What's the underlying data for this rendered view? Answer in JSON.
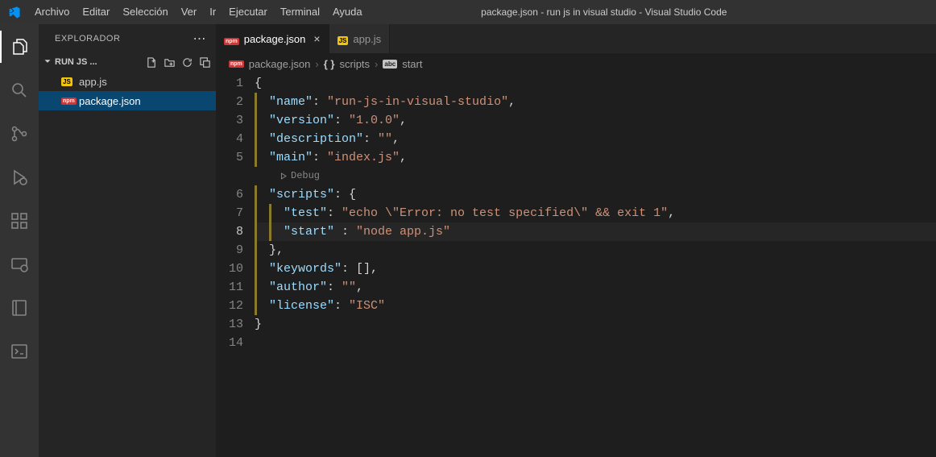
{
  "window_title": "package.json - run js in visual studio - Visual Studio Code",
  "menu": [
    "Archivo",
    "Editar",
    "Selección",
    "Ver",
    "Ir",
    "Ejecutar",
    "Terminal",
    "Ayuda"
  ],
  "sidebar": {
    "title": "EXPLORADOR",
    "section": "RUN JS ...",
    "files": [
      {
        "name": "app.js",
        "iconType": "js",
        "selected": false
      },
      {
        "name": "package.json",
        "iconType": "npm",
        "selected": true
      }
    ]
  },
  "tabs": [
    {
      "label": "package.json",
      "iconType": "npm",
      "active": true,
      "dirty": false,
      "close": true
    },
    {
      "label": "app.js",
      "iconType": "js",
      "active": false,
      "dirty": false,
      "close": false
    }
  ],
  "breadcrumbs": [
    {
      "icon": "npm",
      "label": "package.json"
    },
    {
      "icon": "braces",
      "label": "scripts"
    },
    {
      "icon": "abc",
      "label": "start"
    }
  ],
  "debug_hint": "Debug",
  "active_line": 8,
  "code_lines": [
    {
      "n": 1,
      "tokens": [
        {
          "t": "{",
          "c": "brace"
        }
      ]
    },
    {
      "n": 2,
      "indent": 1,
      "tokens": [
        {
          "t": "\"name\"",
          "c": "key"
        },
        {
          "t": ": ",
          "c": "punc"
        },
        {
          "t": "\"run-js-in-visual-studio\"",
          "c": "str"
        },
        {
          "t": ",",
          "c": "punc"
        }
      ]
    },
    {
      "n": 3,
      "indent": 1,
      "tokens": [
        {
          "t": "\"version\"",
          "c": "key"
        },
        {
          "t": ": ",
          "c": "punc"
        },
        {
          "t": "\"1.0.0\"",
          "c": "str"
        },
        {
          "t": ",",
          "c": "punc"
        }
      ]
    },
    {
      "n": 4,
      "indent": 1,
      "tokens": [
        {
          "t": "\"description\"",
          "c": "key"
        },
        {
          "t": ": ",
          "c": "punc"
        },
        {
          "t": "\"\"",
          "c": "str"
        },
        {
          "t": ",",
          "c": "punc"
        }
      ]
    },
    {
      "n": 5,
      "indent": 1,
      "tokens": [
        {
          "t": "\"main\"",
          "c": "key"
        },
        {
          "t": ": ",
          "c": "punc"
        },
        {
          "t": "\"index.js\"",
          "c": "str"
        },
        {
          "t": ",",
          "c": "punc"
        }
      ]
    },
    {
      "n": 6,
      "indent": 1,
      "tokens": [
        {
          "t": "\"scripts\"",
          "c": "key"
        },
        {
          "t": ": ",
          "c": "punc"
        },
        {
          "t": "{",
          "c": "brace"
        }
      ]
    },
    {
      "n": 7,
      "indent": 2,
      "tokens": [
        {
          "t": "\"test\"",
          "c": "key"
        },
        {
          "t": ": ",
          "c": "punc"
        },
        {
          "t": "\"echo \\\"Error: no test specified\\\" && exit 1\"",
          "c": "str"
        },
        {
          "t": ",",
          "c": "punc"
        }
      ]
    },
    {
      "n": 8,
      "indent": 2,
      "tokens": [
        {
          "t": "\"start\"",
          "c": "key"
        },
        {
          "t": " : ",
          "c": "punc"
        },
        {
          "t": "\"node app.js\"",
          "c": "str"
        }
      ]
    },
    {
      "n": 9,
      "indent": 1,
      "tokens": [
        {
          "t": "}",
          "c": "brace"
        },
        {
          "t": ",",
          "c": "punc"
        }
      ]
    },
    {
      "n": 10,
      "indent": 1,
      "tokens": [
        {
          "t": "\"keywords\"",
          "c": "key"
        },
        {
          "t": ": ",
          "c": "punc"
        },
        {
          "t": "[]",
          "c": "punc"
        },
        {
          "t": ",",
          "c": "punc"
        }
      ]
    },
    {
      "n": 11,
      "indent": 1,
      "tokens": [
        {
          "t": "\"author\"",
          "c": "key"
        },
        {
          "t": ": ",
          "c": "punc"
        },
        {
          "t": "\"\"",
          "c": "str"
        },
        {
          "t": ",",
          "c": "punc"
        }
      ]
    },
    {
      "n": 12,
      "indent": 1,
      "tokens": [
        {
          "t": "\"license\"",
          "c": "key"
        },
        {
          "t": ": ",
          "c": "punc"
        },
        {
          "t": "\"ISC\"",
          "c": "str"
        }
      ]
    },
    {
      "n": 13,
      "tokens": [
        {
          "t": "}",
          "c": "brace"
        }
      ]
    },
    {
      "n": 14,
      "tokens": []
    }
  ]
}
